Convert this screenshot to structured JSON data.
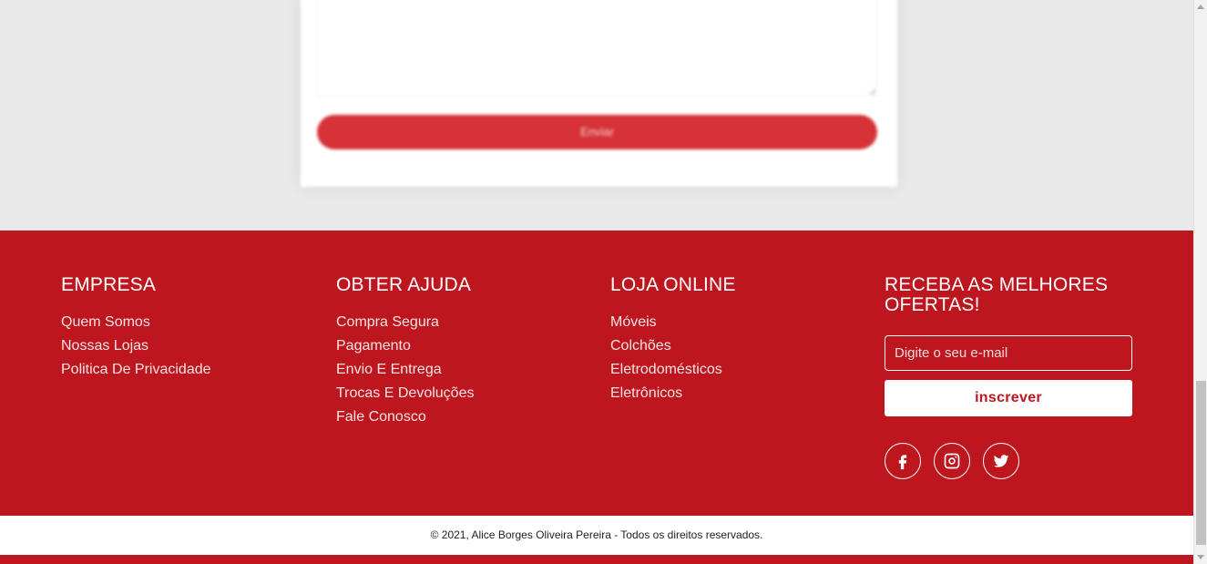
{
  "contact_form": {
    "textarea_placeholder": "",
    "send_label": "Enviar"
  },
  "footer": {
    "company": {
      "title": "EMPRESA",
      "links": [
        "Quem Somos",
        "Nossas Lojas",
        "Politica De Privacidade"
      ]
    },
    "help": {
      "title": "OBTER AJUDA",
      "links": [
        "Compra Segura",
        "Pagamento",
        "Envio E Entrega",
        "Trocas E Devoluções",
        "Fale Conosco"
      ]
    },
    "store": {
      "title": "LOJA ONLINE",
      "links": [
        "Móveis",
        "Colchões",
        "Eletrodomésticos",
        "Eletrônicos"
      ]
    },
    "newsletter": {
      "title": "RECEBA AS MELHORES OFERTAS!",
      "email_placeholder": "Digite o seu e-mail",
      "subscribe_label": "inscrever"
    },
    "socials": [
      "facebook-icon",
      "instagram-icon",
      "twitter-icon"
    ]
  },
  "copyright": "© 2021, Alice Borges Oliveira Pereira - Todos os direitos reservados.",
  "colors": {
    "brand_red": "#be161e",
    "button_red": "#d63238",
    "background": "#e9e9e9"
  }
}
